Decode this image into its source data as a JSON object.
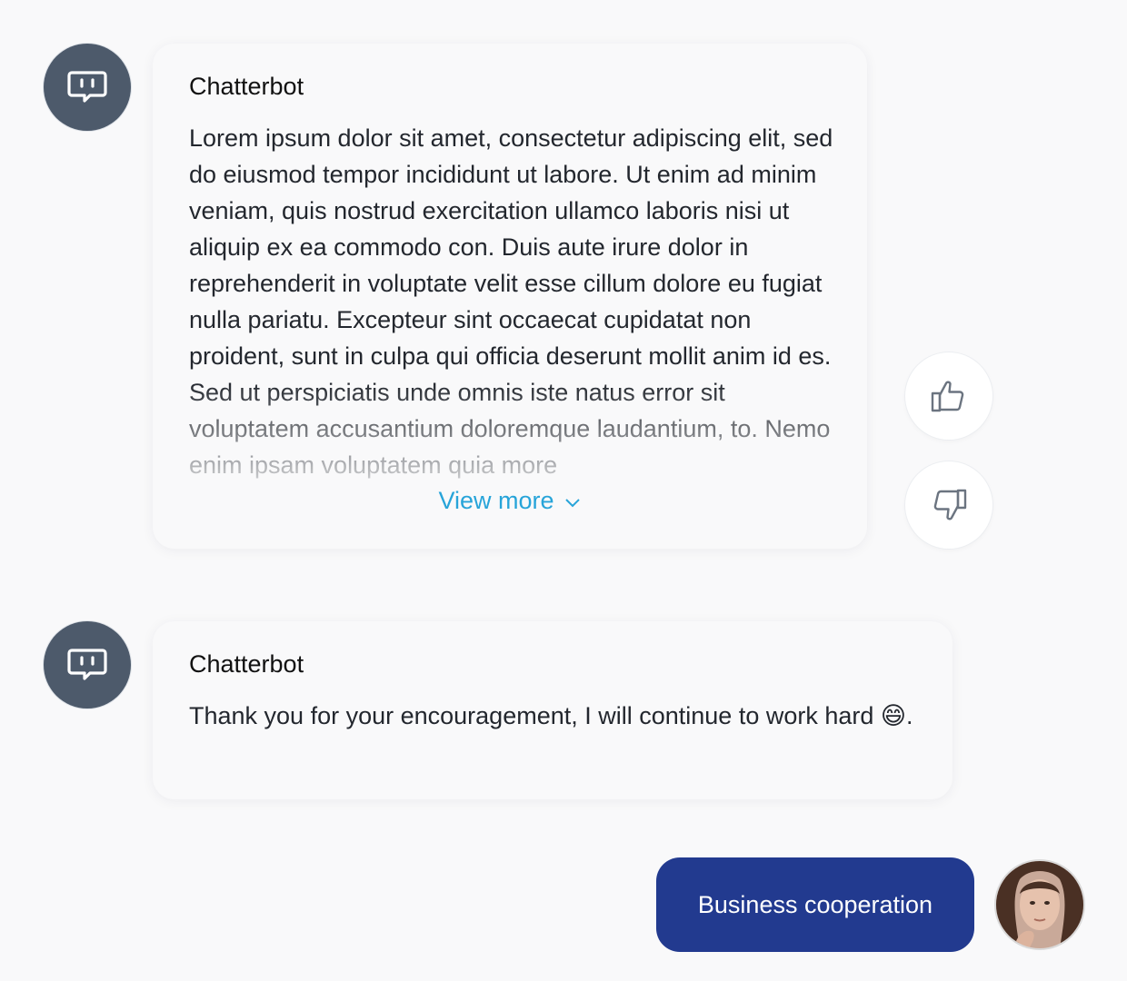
{
  "messages": [
    {
      "sender": "Chatterbot",
      "text": "Lorem ipsum dolor sit amet, consectetur adipiscing elit, sed do eiusmod tempor incididunt ut labore. Ut enim ad minim veniam, quis nostrud exercitation ullamco laboris nisi ut aliquip ex ea commodo con. Duis aute irure dolor in reprehenderit in voluptate velit esse cillum dolore eu fugiat nulla pariatu. Excepteur sint occaecat cupidatat non proident, sunt in culpa qui officia deserunt mollit anim id es. Sed ut perspiciatis unde omnis iste natus error sit voluptatem accusantium doloremque laudantium, to. Nemo enim ipsam voluptatem quia more",
      "view_more_label": "View more"
    },
    {
      "sender": "Chatterbot",
      "text": "Thank you for your encouragement, I will continue to work hard 😄."
    }
  ],
  "user_message": {
    "text": "Business cooperation"
  },
  "icons": {
    "bot_avatar": "chat-bot-icon",
    "like": "thumbs-up-icon",
    "dislike": "thumbs-down-icon",
    "expand": "chevron-down-icon"
  },
  "colors": {
    "background": "#f9f9fa",
    "bot_avatar_bg": "#4d5a6b",
    "accent_link": "#27a4d9",
    "user_bubble": "#223a8f"
  }
}
